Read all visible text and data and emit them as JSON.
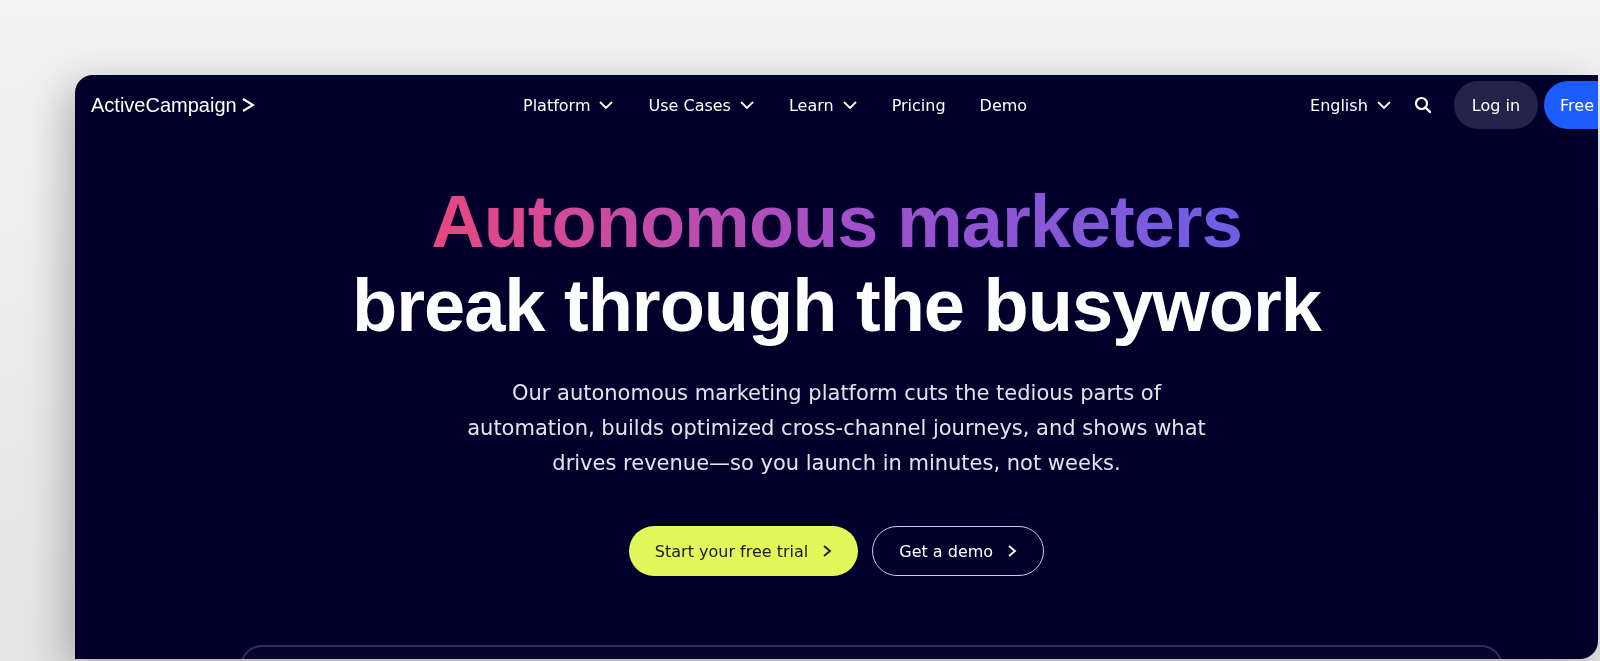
{
  "header": {
    "logo": "ActiveCampaign",
    "nav": [
      {
        "label": "Platform",
        "dropdown": true
      },
      {
        "label": "Use Cases",
        "dropdown": true
      },
      {
        "label": "Learn",
        "dropdown": true
      },
      {
        "label": "Pricing",
        "dropdown": false
      },
      {
        "label": "Demo",
        "dropdown": false
      }
    ],
    "language": "English",
    "login": "Log in",
    "cta": "Free"
  },
  "hero": {
    "headline_accent": "Autonomous marketers",
    "headline": "break through the busywork",
    "description": "Our autonomous marketing platform cuts the tedious parts of automation, builds optimized cross-channel journeys, and shows what drives revenue—so you launch in minutes, not weeks.",
    "buttons": [
      {
        "label": "Start your free trial",
        "kind": "primary"
      },
      {
        "label": "Get a demo",
        "kind": "outline"
      }
    ]
  }
}
